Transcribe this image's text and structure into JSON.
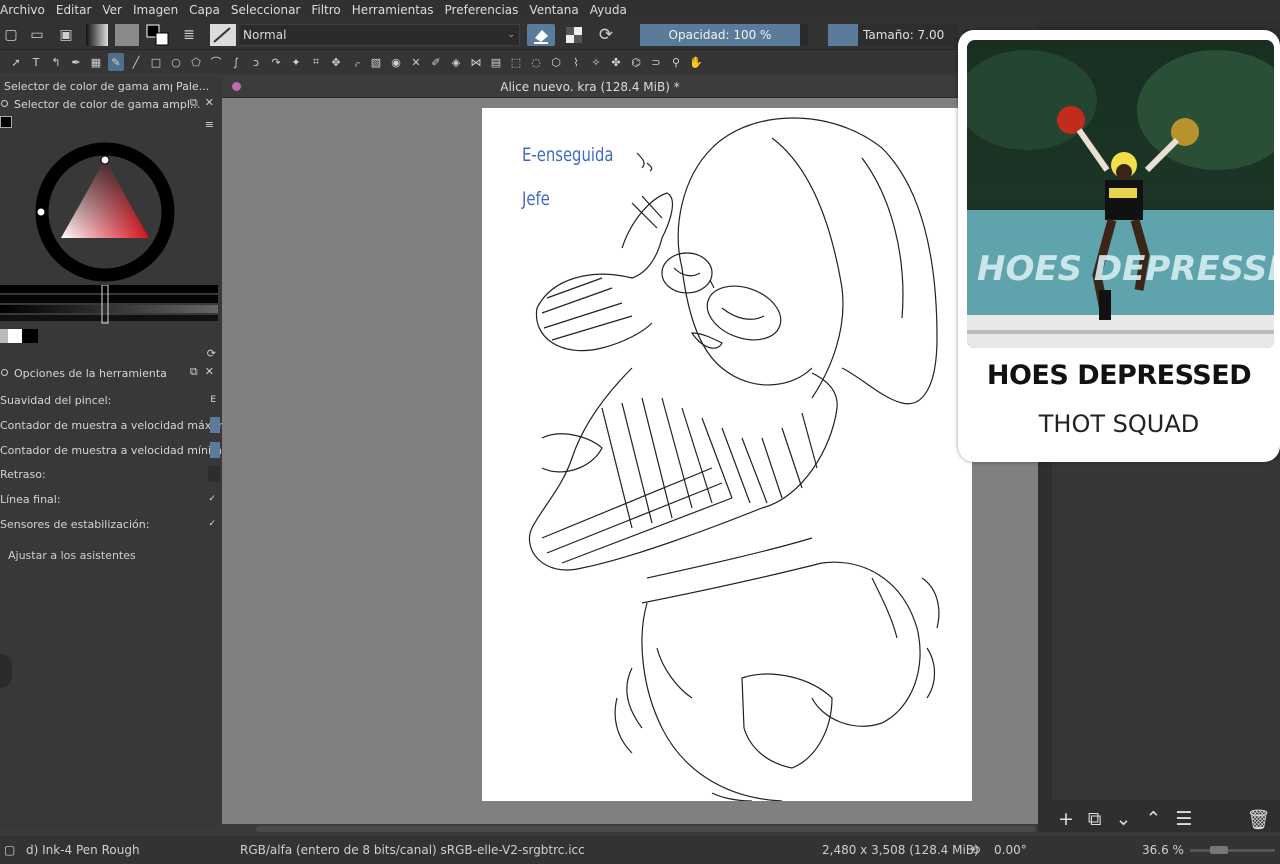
{
  "menubar": {
    "items": [
      "Archivo",
      "Editar",
      "Ver",
      "Imagen",
      "Capa",
      "Seleccionar",
      "Filtro",
      "Herramientas",
      "Preferencias",
      "Ventana",
      "Ayuda"
    ]
  },
  "toolbar": {
    "blend_mode": "Normal",
    "opacity_label": "Opacidad: 100 %",
    "size_label": "Tamaño: 7.00 px"
  },
  "left_docker": {
    "tab_1": "Selector de color de gama ampl...",
    "tab_2": "Pale...",
    "panel_title": "Selector de color de gama ampl...",
    "tool_options_title": "Opciones de la herramienta",
    "options": [
      {
        "label": "Suavidad del pincel:",
        "control": "E"
      },
      {
        "label": "Contador de muestra a velocidad máxima:",
        "control": "blue"
      },
      {
        "label": "Contador de muestra a velocidad mínima:",
        "control": "blue"
      },
      {
        "label": "Retraso:",
        "control": "grey"
      },
      {
        "label": "Línea final:",
        "control": "✓"
      },
      {
        "label": "Sensores de estabilización:",
        "control": "✓"
      }
    ],
    "assistants_label": "Ajustar a los asistentes"
  },
  "document": {
    "tab_title": "Alice nuevo. kra (128.4 MiB) *",
    "overlay_line1": "E-enseguida",
    "overlay_line2": "Jefe"
  },
  "card": {
    "image_caption": "HOES DEPRESSED",
    "title": "HOES DEPRESSED",
    "subtitle": "THOT SQUAD"
  },
  "statusbar": {
    "brush": "d) Ink-4 Pen Rough",
    "color_model": "RGB/alfa (entero de 8 bits/canal)  sRGB-elle-V2-srgbtrc.icc",
    "dimensions": "2,480 x 3,508 (128.4 MiB)",
    "rotation": "0.00°",
    "zoom": "36.6 %"
  },
  "colors": {
    "accent": "#5a7b99",
    "overlay_text": "#3f68c8",
    "canvas_bg": "#808080"
  }
}
